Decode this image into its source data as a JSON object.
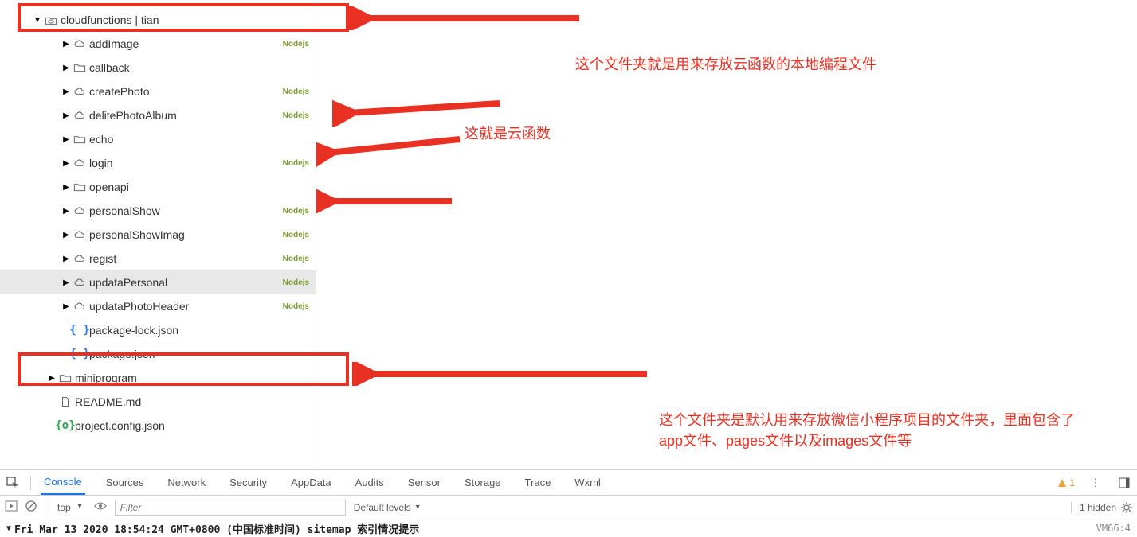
{
  "tree": {
    "root": {
      "label": "cloudfunctions | tian"
    },
    "items": [
      {
        "label": "addImage",
        "kind": "cloud",
        "badge": "Nodejs"
      },
      {
        "label": "callback",
        "kind": "folder",
        "badge": ""
      },
      {
        "label": "createPhoto",
        "kind": "cloud",
        "badge": "Nodejs"
      },
      {
        "label": "delitePhotoAlbum",
        "kind": "cloud",
        "badge": "Nodejs"
      },
      {
        "label": "echo",
        "kind": "folder",
        "badge": ""
      },
      {
        "label": "login",
        "kind": "cloud",
        "badge": "Nodejs"
      },
      {
        "label": "openapi",
        "kind": "folder",
        "badge": ""
      },
      {
        "label": "personalShow",
        "kind": "cloud",
        "badge": "Nodejs"
      },
      {
        "label": "personalShowImag",
        "kind": "cloud",
        "badge": "Nodejs"
      },
      {
        "label": "regist",
        "kind": "cloud",
        "badge": "Nodejs"
      },
      {
        "label": "updataPersonal",
        "kind": "cloud",
        "badge": "Nodejs",
        "hover": true
      },
      {
        "label": "updataPhotoHeader",
        "kind": "cloud",
        "badge": "Nodejs"
      },
      {
        "label": "package-lock.json",
        "kind": "json",
        "badge": "",
        "leaf": true
      },
      {
        "label": "package.json",
        "kind": "json",
        "badge": "",
        "leaf": true
      },
      {
        "label": "miniprogram",
        "kind": "folder",
        "badge": "",
        "level": 1
      },
      {
        "label": "README.md",
        "kind": "file",
        "badge": "",
        "leaf": true,
        "level": 1
      },
      {
        "label": "project.config.json",
        "kind": "jsong",
        "badge": "",
        "leaf": true,
        "level": 1
      }
    ]
  },
  "annotations": {
    "a1": "这个文件夹就是用来存放云函数的本地编程文件",
    "a2": "这就是云函数",
    "a3_line1": "这个文件夹是默认用来存放微信小程序项目的文件夹，里面包含了",
    "a3_line2": "app文件、pages文件以及images文件等"
  },
  "devtools": {
    "tabs": [
      "Console",
      "Sources",
      "Network",
      "Security",
      "AppData",
      "Audits",
      "Sensor",
      "Storage",
      "Trace",
      "Wxml"
    ],
    "active_tab": "Console",
    "warn_count": "1",
    "context": "top",
    "filter_placeholder": "Filter",
    "levels_label": "Default levels",
    "hidden_label": "1 hidden",
    "console_message": "Fri Mar 13 2020 18:54:24 GMT+0800 (中国标准时间) sitemap 索引情况提示",
    "console_src": "VM66:4"
  }
}
